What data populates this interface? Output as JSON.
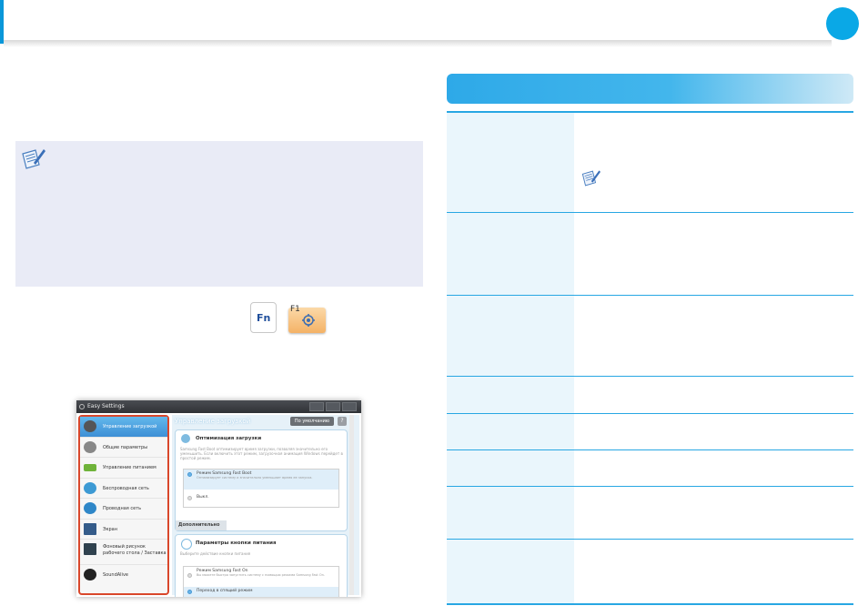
{
  "header": {
    "accent_color": "#0a97d9",
    "circle_color": "#0aa8e6"
  },
  "note_box": {
    "icon": "note-pencil-icon",
    "background": "#e9ebf6"
  },
  "keys": {
    "fn_label": "Fn",
    "f1_label": "F1",
    "f1_icon": "settings-gear-icon"
  },
  "app": {
    "window_title": "Easy Settings",
    "sidebar": [
      {
        "label": "Управление загрузкой",
        "icon": "boot-icon",
        "active": true
      },
      {
        "label": "Общие параметры",
        "icon": "settings-icon"
      },
      {
        "label": "Управление питанием",
        "icon": "battery-icon"
      },
      {
        "label": "Беспроводная сеть",
        "icon": "wireless-icon"
      },
      {
        "label": "Проводная сеть",
        "icon": "wired-network-icon"
      },
      {
        "label": "Экран",
        "icon": "display-icon"
      },
      {
        "label": "Фоновый рисунок рабочего стола / Заставка",
        "icon": "wallpaper-icon"
      },
      {
        "label": "SoundAlive",
        "icon": "sound-icon"
      }
    ],
    "main_heading": "Управление загрузкой",
    "default_button": "По умолчанию",
    "help_button": "?",
    "panel1": {
      "title": "Оптимизация загрузки",
      "desc": "Samsung Fast Boot оптимизирует время загрузки, позволяя значительно его уменьшить. Если включить этот режим, загрузочная анимация Windows перейдет в простой режим.",
      "options": [
        {
          "label": "Режим Samsung Fast Boot",
          "sub": "Оптимизирует систему и значительно уменьшает время ее запуска.",
          "selected": true
        },
        {
          "label": "Выкл.",
          "sub": "",
          "selected": false
        }
      ],
      "extra_tab": "Дополнительно"
    },
    "panel2": {
      "title": "Параметры кнопки питания",
      "desc": "Выберите действие кнопки питания",
      "options": [
        {
          "label": "Режим Samsung Fast On",
          "sub": "Вы можете быстро запустить систему с помощью режима Samsung Fast On.",
          "selected": false
        },
        {
          "label": "Переход в спящий режим",
          "sub": "",
          "selected": true
        }
      ]
    }
  },
  "table": {
    "header_color": "#2ea9e8",
    "row_note_icon": "note-pencil-icon"
  }
}
